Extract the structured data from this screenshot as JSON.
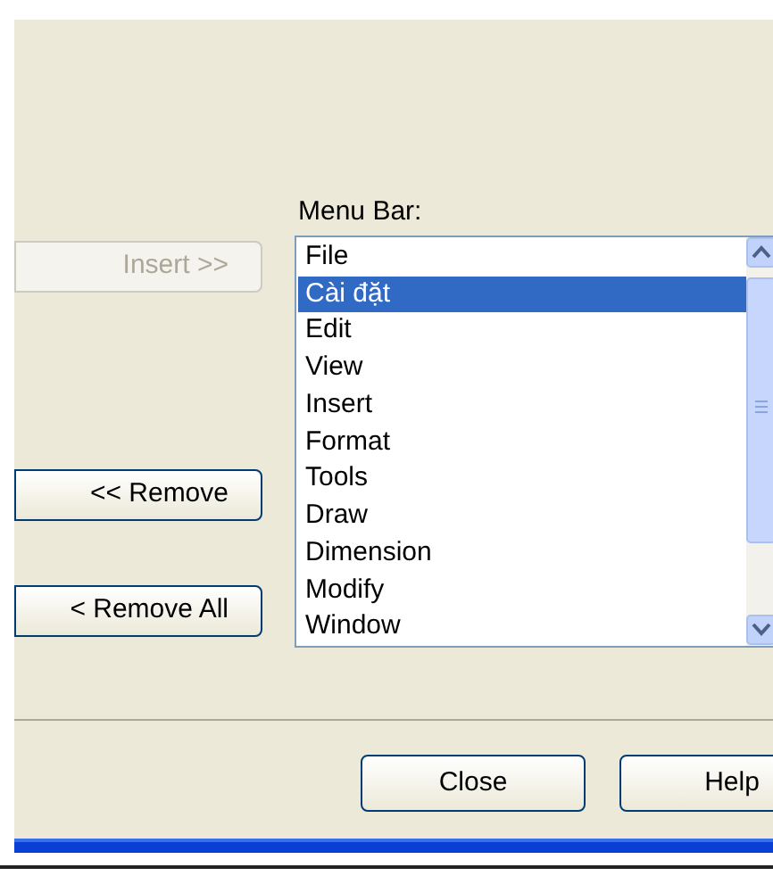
{
  "menu_bar_label": "Menu Bar:",
  "buttons": [
    {
      "label": "Insert >>",
      "disabled": true
    },
    {
      "label": "<< Remove",
      "disabled": false
    },
    {
      "label": "< Remove All",
      "disabled": false
    }
  ],
  "menu_bar_list": [
    {
      "label": "File",
      "selected": false
    },
    {
      "label": "Cài đặt",
      "selected": true
    },
    {
      "label": "Edit",
      "selected": false
    },
    {
      "label": "View",
      "selected": false
    },
    {
      "label": "Insert",
      "selected": false
    },
    {
      "label": "Format",
      "selected": false
    },
    {
      "label": "Tools",
      "selected": false
    },
    {
      "label": "Draw",
      "selected": false
    },
    {
      "label": "Dimension",
      "selected": false
    },
    {
      "label": "Modify",
      "selected": false
    },
    {
      "label": "Window",
      "selected": false
    }
  ],
  "footer_buttons": [
    "Close",
    "Help"
  ]
}
